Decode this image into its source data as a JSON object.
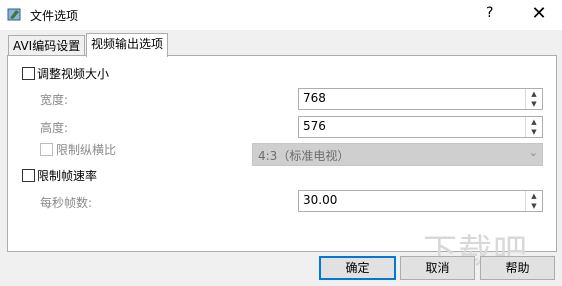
{
  "window": {
    "title": "文件选项",
    "help": "?",
    "close": "✕"
  },
  "tabs": [
    {
      "label": "AVI编码设置"
    },
    {
      "label": "视频输出选项"
    }
  ],
  "resize": {
    "label": "调整视频大小",
    "width_label": "宽度:",
    "width_value": "768",
    "height_label": "高度:",
    "height_value": "576",
    "aspect_label": "限制纵横比",
    "aspect_value": "4:3（标准电视）"
  },
  "framerate": {
    "label": "限制帧速率",
    "fps_label": "每秒帧数:",
    "fps_value": "30.00"
  },
  "buttons": {
    "ok": "确定",
    "cancel": "取消",
    "help": "帮助"
  },
  "watermark": "下载吧",
  "icons": {
    "spin_up": "▲",
    "spin_down": "▼",
    "dropdown": "⌄"
  }
}
